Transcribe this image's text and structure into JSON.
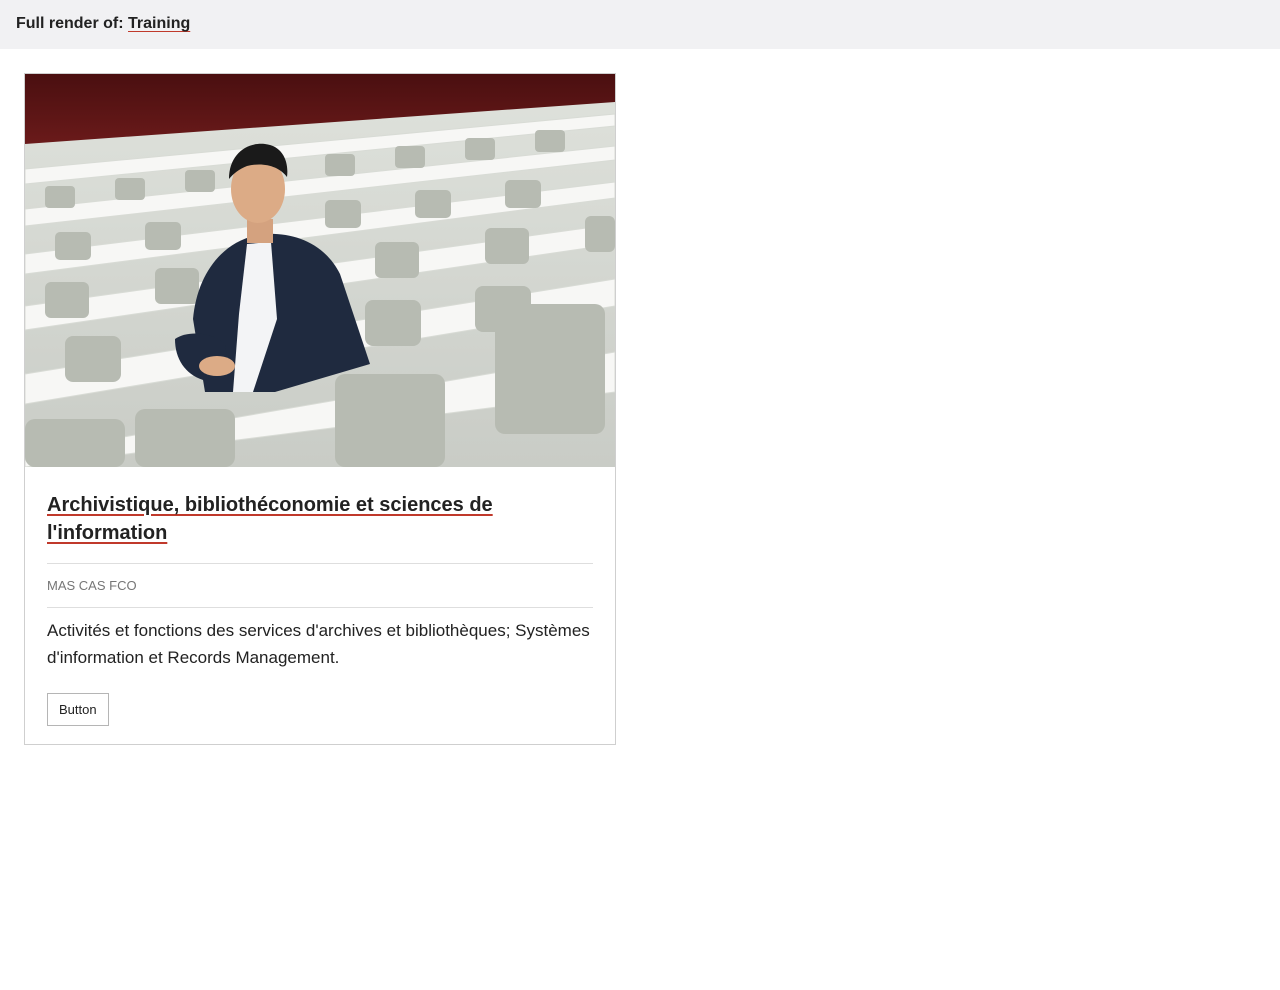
{
  "header": {
    "prefix": "Full render of:",
    "link_label": "Training"
  },
  "card": {
    "image_alt": "Man in a dark blazer seated in an empty lecture hall with rows of white desks and grey chairs",
    "title": "Archivistique, bibliothéconomie et sciences de l'information",
    "meta": "MAS CAS FCO",
    "description": "Activités et fonctions des services d'archives et bibliothèques; Systèmes d'information et Records Management.",
    "button_label": "Button"
  },
  "colors": {
    "link_underline": "#c0392b",
    "header_bg": "#f1f1f3",
    "card_border": "#cfcfcf",
    "hall_wall": "#5a1414"
  }
}
